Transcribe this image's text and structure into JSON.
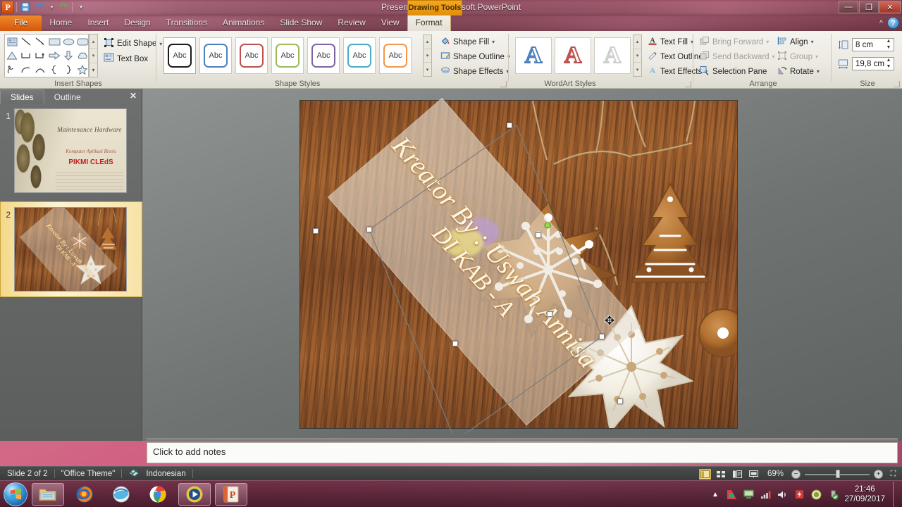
{
  "window": {
    "title": "Presentation1  -  Microsoft PowerPoint",
    "contextual_tab_group": "Drawing Tools",
    "minimize": "—",
    "restore": "❐",
    "close": "✕",
    "ribbon_collapse": "^",
    "help": "?"
  },
  "quick_access": {
    "app_letter": "P",
    "save": "save-icon",
    "undo": "undo-icon",
    "undo_caret": "▾",
    "redo": "redo-icon",
    "customize": "▾"
  },
  "tabs": [
    {
      "label": "File",
      "state": "file"
    },
    {
      "label": "Home",
      "state": "normal"
    },
    {
      "label": "Insert",
      "state": "normal"
    },
    {
      "label": "Design",
      "state": "normal"
    },
    {
      "label": "Transitions",
      "state": "normal"
    },
    {
      "label": "Animations",
      "state": "normal"
    },
    {
      "label": "Slide Show",
      "state": "normal"
    },
    {
      "label": "Review",
      "state": "normal"
    },
    {
      "label": "View",
      "state": "normal"
    },
    {
      "label": "Format",
      "state": "active"
    }
  ],
  "ribbon": {
    "groups": [
      {
        "name": "Insert Shapes",
        "label": "Insert Shapes"
      },
      {
        "name": "Shape Styles",
        "label": "Shape Styles"
      },
      {
        "name": "WordArt Styles",
        "label": "WordArt Styles"
      },
      {
        "name": "Arrange",
        "label": "Arrange"
      },
      {
        "name": "Size",
        "label": "Size"
      }
    ],
    "insert_shapes": {
      "edit_shape": "Edit Shape",
      "edit_shape_caret": "▾",
      "text_box": "Text Box",
      "scroll_up": "▴",
      "scroll_down": "▾",
      "more": "▾"
    },
    "shape_styles": {
      "swatch_label": "Abc",
      "colors": [
        "#1a1a1a",
        "#4f81bd",
        "#c0504d",
        "#9bbb59",
        "#8064a2",
        "#4bacc6",
        "#f79646"
      ],
      "selected_index": 0
    },
    "shape_commands": [
      {
        "label": "Shape Fill",
        "caret": "▾",
        "icon": "paint-bucket-icon"
      },
      {
        "label": "Shape Outline",
        "caret": "▾",
        "icon": "pencil-outline-icon"
      },
      {
        "label": "Shape Effects",
        "caret": "▾",
        "icon": "shape-effects-icon"
      }
    ],
    "wordart_styles": {
      "letter": "A",
      "colors": [
        "#4f81bd",
        "#c0504d",
        "#d9d9d9"
      ]
    },
    "text_commands": [
      {
        "label": "Text Fill",
        "caret": "▾",
        "icon": "text-fill-icon"
      },
      {
        "label": "Text Outline",
        "caret": "▾",
        "icon": "text-outline-icon"
      },
      {
        "label": "Text Effects",
        "caret": "▾",
        "icon": "text-effects-icon"
      }
    ],
    "arrange": [
      {
        "label": "Bring Forward",
        "caret": "▾",
        "icon": "bring-forward-icon",
        "disabled": true
      },
      {
        "label": "Send Backward",
        "caret": "▾",
        "icon": "send-backward-icon",
        "disabled": true
      },
      {
        "label": "Selection Pane",
        "caret": "",
        "icon": "selection-pane-icon",
        "disabled": false
      },
      {
        "label": "Align",
        "caret": "▾",
        "icon": "align-icon",
        "disabled": false
      },
      {
        "label": "Group",
        "caret": "▾",
        "icon": "group-icon",
        "disabled": true
      },
      {
        "label": "Rotate",
        "caret": "▾",
        "icon": "rotate-icon",
        "disabled": false
      }
    ],
    "size": {
      "height_icon": "shape-height-icon",
      "height_value": "8 cm",
      "width_icon": "shape-width-icon",
      "width_value": "19,8 cm",
      "spin_up": "▲",
      "spin_down": "▼"
    }
  },
  "slides_pane": {
    "tab_slides": "Slides",
    "tab_outline": "Outline",
    "close": "✕",
    "thumbnails": [
      {
        "number": "1",
        "selected": false,
        "title": "Maintenance Hardware",
        "subtitle": "Komputer Aplikasi Bisnis",
        "highlight": "PIKMI CLEdS"
      },
      {
        "number": "2",
        "selected": true,
        "text_line1": "Kreator By : Uswah Annisa",
        "text_line2": "DI KAB - A"
      }
    ]
  },
  "slide_canvas": {
    "shape_text_line1": "Kreator By : Uswah Annisa",
    "shape_text_line2": "DI KAB - A",
    "cursor": "move-cursor",
    "rotation_handle": "rotate-handle"
  },
  "notes": {
    "placeholder": "Click to add notes"
  },
  "status_bar": {
    "slide_counter": "Slide 2 of 2",
    "theme": "\"Office Theme\"",
    "spelling_icon": "spell-check-icon",
    "language": "Indonesian",
    "views": [
      {
        "name": "normal-view",
        "glyph": "▤",
        "active": true
      },
      {
        "name": "slide-sorter-view",
        "glyph": "⠿",
        "active": false
      },
      {
        "name": "reading-view",
        "glyph": "▥",
        "active": false
      },
      {
        "name": "slide-show-view",
        "glyph": "▣",
        "active": false
      }
    ],
    "zoom_level": "69%",
    "zoom_out": "−",
    "zoom_in": "+",
    "fit_to_window": "⛶"
  },
  "taskbar": {
    "start": "start-orb",
    "items": [
      {
        "name": "windows-explorer",
        "open": true
      },
      {
        "name": "mozilla-firefox",
        "open": false
      },
      {
        "name": "internet-explorer",
        "open": false
      },
      {
        "name": "google-chrome",
        "open": false
      },
      {
        "name": "windows-media-player",
        "open": true
      },
      {
        "name": "microsoft-powerpoint",
        "open": true
      }
    ],
    "tray": {
      "show_hidden": "▲",
      "icons": [
        "kaspersky-icon",
        "network-monitor-icon",
        "signal-icon",
        "volume-icon",
        "battery-icon",
        "shield-icon",
        "antivirus-icon"
      ],
      "time": "21:46",
      "date": "27/09/2017"
    }
  }
}
